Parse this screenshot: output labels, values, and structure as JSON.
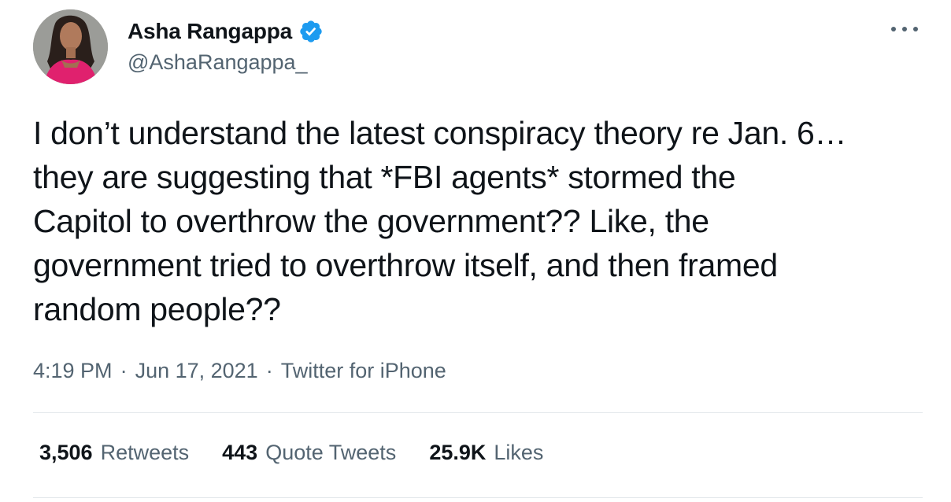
{
  "author": {
    "display_name": "Asha Rangappa",
    "handle": "@AshaRangappa_",
    "verified_icon": "verified-badge-icon",
    "avatar": "profile-photo"
  },
  "tweet": {
    "text": "I don’t understand the latest conspiracy theory re Jan. 6…\nthey are suggesting that *FBI agents* stormed the\nCapitol to overthrow the government?? Like, the\ngovernment tried to overthrow itself, and then framed\nrandom people??",
    "time": "4:19 PM",
    "date": "Jun 17, 2021",
    "source": "Twitter for iPhone",
    "separator": "·"
  },
  "stats": {
    "retweets_count": "3,506",
    "retweets_label": "Retweets",
    "quotes_count": "443",
    "quotes_label": "Quote Tweets",
    "likes_count": "25.9K",
    "likes_label": "Likes"
  },
  "colors": {
    "text_primary": "#0f1419",
    "text_secondary": "#536471",
    "verified_blue": "#1d9bf0",
    "divider": "#e3e8eb"
  }
}
